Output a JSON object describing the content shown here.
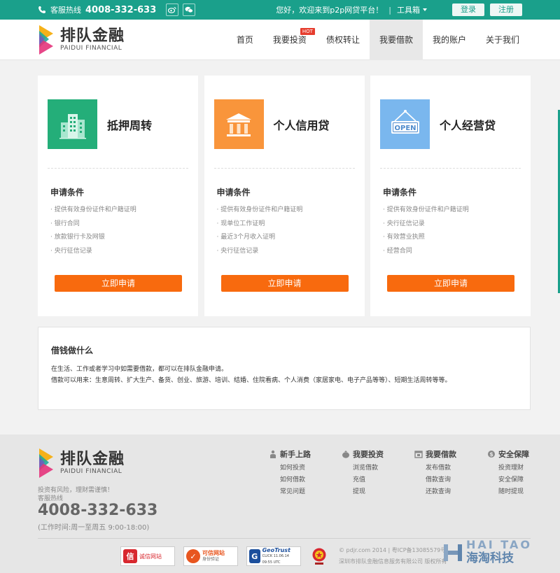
{
  "topbar": {
    "hotline_label": "客服热线",
    "hotline": "4008-332-633",
    "welcome": "您好，欢迎来到p2p网贷平台！",
    "separator": "|",
    "toolbox": "工具箱",
    "login": "登录",
    "register": "注册",
    "bg_color": "#1aa08b"
  },
  "logo": {
    "name_cn": "排队金融",
    "name_en": "PAIDUI FINANCIAL"
  },
  "nav": {
    "items": [
      {
        "label": "首页"
      },
      {
        "label": "我要投资",
        "badge": "HOT"
      },
      {
        "label": "债权转让"
      },
      {
        "label": "我要借款"
      },
      {
        "label": "我的账户"
      },
      {
        "label": "关于我们"
      }
    ],
    "active_index": 3
  },
  "cards": [
    {
      "title": "抵押周转",
      "icon": "buildings-icon",
      "icon_color": "#24ae79",
      "cond_title": "申请条件",
      "conditions": [
        "· 提供有效身份证件和户籍证明",
        "· 银行合同",
        "· 放款银行卡及网银",
        "· 央行征信记录"
      ],
      "button": "立即申请"
    },
    {
      "title": "个人信用贷",
      "icon": "bank-icon",
      "icon_color": "#f9953b",
      "cond_title": "申请条件",
      "conditions": [
        "· 提供有效身份证件和户籍证明",
        "· 现单位工作证明",
        "· 最近3个月收入证明",
        "· 央行征信记录"
      ],
      "button": "立即申请"
    },
    {
      "title": "个人经营贷",
      "icon": "open-sign-icon",
      "icon_color": "#7ab7ee",
      "icon_text": "OPEN",
      "cond_title": "申请条件",
      "conditions": [
        "· 提供有效身份证件和户籍证明",
        "· 央行征信记录",
        "· 有效营业执照",
        "· 经营合同"
      ],
      "button": "立即申请"
    }
  ],
  "info": {
    "title": "借钱做什么",
    "p1": "在生活、工作或者学习中如需要借款，都可以在排队金融申请。",
    "p2": "借款可以用来：生意周转、扩大生产、备货、创业、旅游、培训、结婚、住院看病、个人消费（家居家电、电子产品等等）、短期生活周转等等。"
  },
  "footer": {
    "logo_cn": "排队金融",
    "logo_en": "PAIDUI FINANCIAL",
    "risk": "投资有风险，理财需谨慎！",
    "hotline_label": "客服热线",
    "phone": "4008-332-633",
    "hours": "(工作时间:周一至周五 9:00-18:00)",
    "columns": [
      {
        "title": "新手上路",
        "icon": "person-icon",
        "links": [
          "如何投资",
          "如何借款",
          "常见问题"
        ]
      },
      {
        "title": "我要投资",
        "icon": "moneybag-icon",
        "links": [
          "浏览借款",
          "充值",
          "提现"
        ]
      },
      {
        "title": "我要借款",
        "icon": "calendar-icon",
        "links": [
          "发布借款",
          "借款查询",
          "还款查询"
        ]
      },
      {
        "title": "安全保障",
        "icon": "coin-icon",
        "links": [
          "投资理财",
          "安全保障",
          "随时提现"
        ]
      }
    ],
    "badges": [
      {
        "text": "诚信网站",
        "icon_char": "信",
        "color": "#d8282f"
      },
      {
        "text": "可信网站",
        "sub": "身份验证",
        "icon_char": "✓",
        "color": "#e8561f"
      },
      {
        "text": "GeoTrust",
        "sub": "CLICK 11.06.14 09:55 UTC",
        "icon_char": "G",
        "color": "#1c4f9c"
      }
    ],
    "copyright1": "© pdjr.com 2014 | 粤ICP备13085579号",
    "copyright2": "深圳市排队金融信息服务有限公司 版权所有",
    "watermark_en": "HAI TAO",
    "watermark_cn": "海淘科技"
  }
}
